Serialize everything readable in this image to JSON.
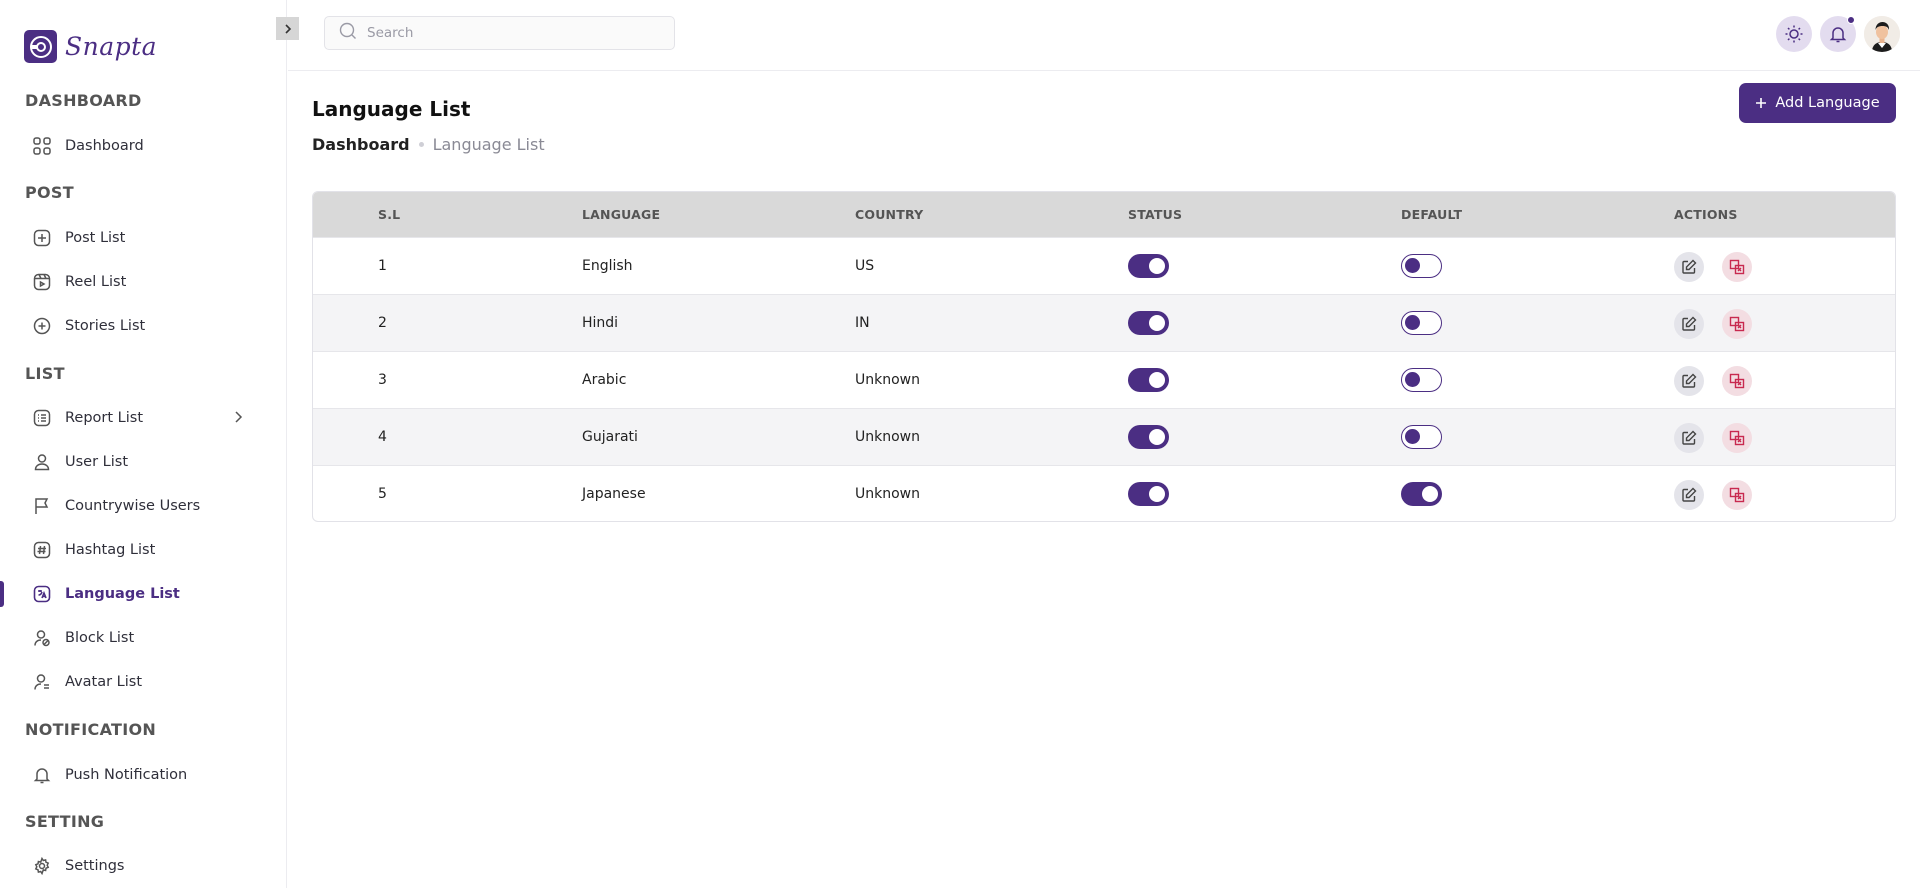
{
  "app": {
    "brand": "Snapta"
  },
  "sidebar": {
    "sections": [
      {
        "label": "DASHBOARD"
      },
      {
        "label": "POST"
      },
      {
        "label": "LIST"
      },
      {
        "label": "NOTIFICATION"
      },
      {
        "label": "SETTING"
      }
    ],
    "items": [
      {
        "label": "Dashboard",
        "icon": "grid-icon"
      },
      {
        "label": "Post List",
        "icon": "plus-square-icon"
      },
      {
        "label": "Reel List",
        "icon": "reel-icon"
      },
      {
        "label": "Stories List",
        "icon": "plus-circle-icon"
      },
      {
        "label": "Report List",
        "icon": "report-icon"
      },
      {
        "label": "User List",
        "icon": "user-icon"
      },
      {
        "label": "Countrywise Users",
        "icon": "flag-icon"
      },
      {
        "label": "Hashtag List",
        "icon": "hashtag-icon"
      },
      {
        "label": "Language List",
        "icon": "translate-icon",
        "active": true
      },
      {
        "label": "Block List",
        "icon": "user-block-icon"
      },
      {
        "label": "Avatar List",
        "icon": "avatar-icon"
      },
      {
        "label": "Push Notification",
        "icon": "bell-icon"
      },
      {
        "label": "Settings",
        "icon": "gear-icon"
      }
    ]
  },
  "topbar": {
    "search": {
      "placeholder": "Search",
      "value": ""
    }
  },
  "main": {
    "title": "Language List",
    "breadcrumb": {
      "home": "Dashboard",
      "current": "Language List"
    },
    "add_button": "Add Language"
  },
  "table": {
    "columns": [
      "S.L",
      "LANGUAGE",
      "COUNTRY",
      "STATUS",
      "DEFAULT",
      "ACTIONS"
    ],
    "rows": [
      {
        "sl": "1",
        "language": "English",
        "country": "US",
        "status": true,
        "default": false
      },
      {
        "sl": "2",
        "language": "Hindi",
        "country": "IN",
        "status": true,
        "default": false
      },
      {
        "sl": "3",
        "language": "Arabic",
        "country": "Unknown",
        "status": true,
        "default": false
      },
      {
        "sl": "4",
        "language": "Gujarati",
        "country": "Unknown",
        "status": true,
        "default": false
      },
      {
        "sl": "5",
        "language": "Japanese",
        "country": "Unknown",
        "status": true,
        "default": true
      }
    ]
  },
  "colors": {
    "accent": "#4b2e83",
    "header_bg": "#d9d9d9",
    "delete": "#c8294f"
  }
}
